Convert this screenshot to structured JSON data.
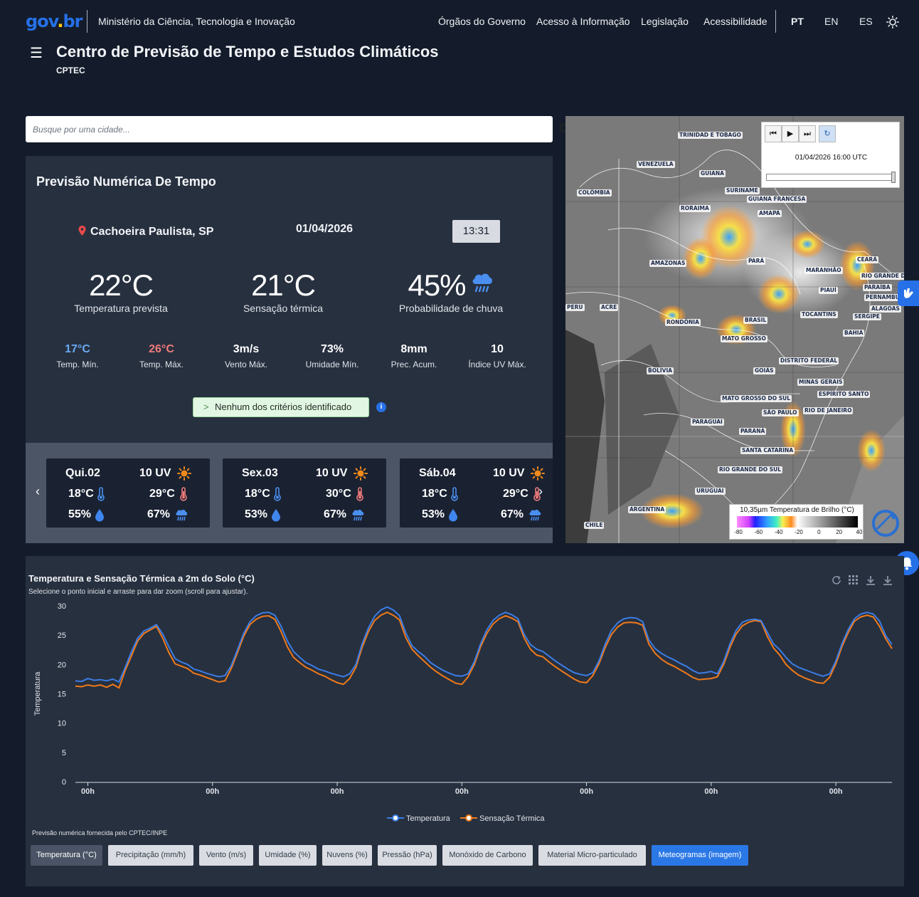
{
  "header": {
    "logo_parts": [
      "gov",
      ".",
      "br"
    ],
    "ministry": "Ministério da Ciência, Tecnologia e Inovação",
    "nav": [
      "Órgãos do Governo",
      "Acesso à Informação",
      "Legislação",
      "Acessibilidade"
    ],
    "languages": [
      "PT",
      "EN",
      "ES"
    ],
    "active_language": "PT",
    "site_title": "Centro de Previsão de Tempo e Estudos Climáticos",
    "site_subtitle": "CPTEC"
  },
  "search": {
    "placeholder": "Busque por uma cidade..."
  },
  "forecast": {
    "title": "Previsão Numérica De Tempo",
    "location": "Cachoeira Paulista, SP",
    "date": "01/04/2026",
    "time": "13:31",
    "temperature": "22°C",
    "temperature_label": "Temperatura prevista",
    "feels_like": "21°C",
    "feels_like_label": "Sensação térmica",
    "rain_prob": "45%",
    "rain_prob_label": "Probabilidade de chuva",
    "stats": [
      {
        "value": "17°C",
        "label": "Temp. Mín.",
        "color": "#6aaaf5"
      },
      {
        "value": "26°C",
        "label": "Temp. Máx.",
        "color": "#f07a7a"
      },
      {
        "value": "3m/s",
        "label": "Vento Máx.",
        "color": "#ffffff"
      },
      {
        "value": "73%",
        "label": "Umidade Mín.",
        "color": "#ffffff"
      },
      {
        "value": "8mm",
        "label": "Prec. Acum.",
        "color": "#ffffff"
      },
      {
        "value": "10",
        "label": "Índice UV Máx.",
        "color": "#ffffff"
      }
    ],
    "criteria": "Nenhum dos critérios identificado",
    "info_glyph": "i"
  },
  "daily": {
    "prev_glyph": "‹",
    "next_glyph": "›",
    "days": [
      {
        "name": "Qui.02",
        "uv": "10 UV",
        "min": "18°C",
        "max": "29°C",
        "humidity": "55%",
        "rain": "67%"
      },
      {
        "name": "Sex.03",
        "uv": "10 UV",
        "min": "18°C",
        "max": "30°C",
        "humidity": "53%",
        "rain": "67%"
      },
      {
        "name": "Sáb.04",
        "uv": "10 UV",
        "min": "18°C",
        "max": "29°C",
        "humidity": "53%",
        "rain": "67%"
      }
    ]
  },
  "map": {
    "controls": [
      "⏮",
      "▶",
      "⏭",
      "↻"
    ],
    "timestamp": "01/04/2026 16:00 UTC",
    "slider_value": 1.0,
    "legend_title": "10,35µm Temperatura de Brilho (°C)",
    "legend_ticks": [
      "-80",
      "-60",
      "-40",
      "-20",
      "0",
      "20",
      "40"
    ],
    "labels": [
      "TRINIDAD E TOBAGO",
      "VENEZUELA",
      "GUIANA",
      "SURINAME",
      "GUIANA FRANCESA",
      "COLÔMBIA",
      "RORAIMA",
      "AMAPÁ",
      "AMAZONAS",
      "PARÁ",
      "MARANHÃO",
      "CEARÁ",
      "RIO GRANDE DO NORTE",
      "PARAÍBA",
      "PERNAMBUCO",
      "PIAUÍ",
      "ALAGOAS",
      "SERGIPE",
      "PERU",
      "ACRE",
      "TOCANTINS",
      "BRASIL",
      "RONDÔNIA",
      "BAHIA",
      "MATO GROSSO",
      "BOLÍVIA",
      "DISTRITO FEDERAL",
      "GOIÁS",
      "MINAS GERAIS",
      "ESPÍRITO SANTO",
      "MATO GROSSO DO SUL",
      "SÃO PAULO",
      "RIO DE JANEIRO",
      "PARAGUAI",
      "PARANÁ",
      "SANTA CATARINA",
      "RIO GRANDE DO SUL",
      "URUGUAI",
      "ARGENTINA",
      "CHILE"
    ]
  },
  "chart": {
    "title": "Temperatura e Sensação Térmica a 2m do Solo (°C)",
    "subtitle": "Selecione o ponto inicial e arraste para dar zoom (scroll para ajustar).",
    "source": "Previsão numérica fornecida pelo CPTEC/INPE",
    "tabs": [
      "Temperatura (°C)",
      "Precipitação (mm/h)",
      "Vento (m/s)",
      "Umidade (%)",
      "Nuvens (%)",
      "Pressão (hPa)",
      "Monóxido de Carbono",
      "Material Micro-particulado",
      "Meteogramas (imagem)"
    ],
    "selected_tab": 0
  },
  "chart_data": {
    "type": "line",
    "ylabel": "Temperatura",
    "ylim": [
      0,
      30
    ],
    "yticks": [
      0,
      5,
      10,
      15,
      20,
      25,
      30
    ],
    "xticks": [
      "00h",
      "00h",
      "00h",
      "00h",
      "00h",
      "00h",
      "00h"
    ],
    "grid": false,
    "legend": "bottom",
    "series": [
      {
        "name": "Temperatura",
        "color": "#3b7de6",
        "values": [
          17.2,
          17.1,
          17.6,
          17.3,
          17.4,
          17.2,
          17.5,
          17.0,
          19.5,
          22.2,
          24.5,
          25.7,
          26.2,
          26.8,
          25.2,
          23.0,
          21.0,
          20.4,
          20.0,
          19.2,
          18.9,
          18.5,
          18.2,
          17.9,
          18.1,
          19.8,
          22.5,
          25.3,
          27.3,
          28.3,
          28.8,
          28.9,
          28.4,
          26.5,
          24.0,
          22.2,
          21.2,
          20.3,
          19.8,
          19.2,
          18.9,
          18.5,
          18.2,
          17.9,
          18.4,
          20.0,
          23.5,
          26.2,
          28.2,
          29.3,
          29.8,
          29.3,
          28.3,
          25.4,
          23.2,
          22.2,
          21.4,
          20.3,
          19.6,
          19.0,
          18.5,
          18.1,
          18.0,
          18.4,
          20.5,
          23.5,
          25.9,
          27.5,
          28.4,
          28.9,
          28.5,
          27.8,
          25.1,
          23.4,
          22.6,
          22.2,
          21.4,
          20.6,
          19.9,
          19.2,
          18.6,
          18.3,
          18.1,
          18.6,
          20.6,
          23.5,
          25.8,
          27.1,
          27.8,
          28.0,
          27.9,
          27.3,
          24.2,
          22.7,
          21.9,
          21.3,
          20.8,
          20.2,
          19.7,
          19.0,
          18.5,
          18.6,
          18.8,
          18.4,
          20.5,
          23.5,
          25.8,
          27.2,
          27.6,
          27.7,
          27.5,
          25.5,
          23.5,
          22.5,
          21.2,
          20.1,
          19.5,
          19.1,
          18.7,
          18.3,
          18.0,
          18.4,
          20.6,
          23.6,
          26.0,
          27.8,
          28.6,
          28.9,
          28.6,
          27.4,
          24.9,
          23.4
        ]
      },
      {
        "name": "Sensação Térmica",
        "color": "#f07a1a",
        "values": [
          16.3,
          16.2,
          16.5,
          16.3,
          16.5,
          16.1,
          16.6,
          16.0,
          19.0,
          21.5,
          24.0,
          25.3,
          25.9,
          26.5,
          24.5,
          22.0,
          20.1,
          19.7,
          19.3,
          18.5,
          18.2,
          17.8,
          17.4,
          17.0,
          17.2,
          19.3,
          22.0,
          24.8,
          26.8,
          27.7,
          28.2,
          28.3,
          27.7,
          25.6,
          23.0,
          21.2,
          20.3,
          19.5,
          19.0,
          18.4,
          18.0,
          17.4,
          16.9,
          16.6,
          17.6,
          19.5,
          22.9,
          25.6,
          27.5,
          28.4,
          28.9,
          28.4,
          27.6,
          24.6,
          22.6,
          21.5,
          20.5,
          19.5,
          18.7,
          18.0,
          17.4,
          16.8,
          16.6,
          17.9,
          20.0,
          23.0,
          25.3,
          26.9,
          27.8,
          28.3,
          27.9,
          27.3,
          24.5,
          22.6,
          21.6,
          21.3,
          20.4,
          19.6,
          18.9,
          18.2,
          17.5,
          17.0,
          16.9,
          18.1,
          20.1,
          22.9,
          25.1,
          26.4,
          27.1,
          27.2,
          27.1,
          26.7,
          23.5,
          21.9,
          20.9,
          20.2,
          19.7,
          19.1,
          18.5,
          17.8,
          17.4,
          17.5,
          17.6,
          17.9,
          20.0,
          22.9,
          25.2,
          26.6,
          27.2,
          27.5,
          27.3,
          24.8,
          22.8,
          21.6,
          20.0,
          19.0,
          18.2,
          17.7,
          17.3,
          16.9,
          16.8,
          17.8,
          20.1,
          23.1,
          25.5,
          27.4,
          28.1,
          28.4,
          28.1,
          26.5,
          24.4,
          22.7
        ]
      }
    ]
  }
}
